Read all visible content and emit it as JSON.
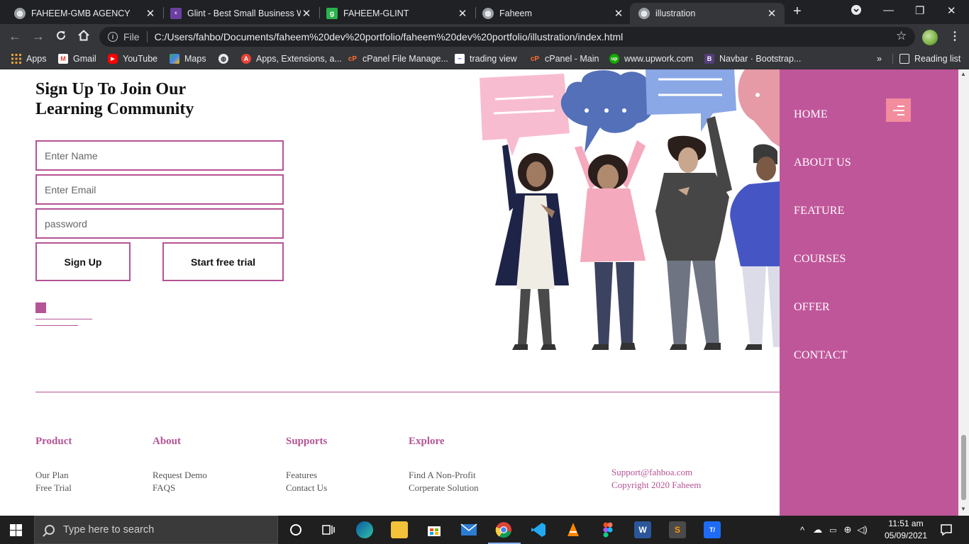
{
  "browser": {
    "tabs": [
      {
        "title": "FAHEEM-GMB AGENCY",
        "icon": "globe-icon",
        "color": "#9aa0a6"
      },
      {
        "title": "Glint - Best Small Business W",
        "icon": "colorlib-icon",
        "color": "#6b3fa0",
        "glyph": "c"
      },
      {
        "title": "FAHEEM-GLINT",
        "icon": "glint-g-icon",
        "color": "#2bb24c",
        "glyph": "g"
      },
      {
        "title": "Faheem",
        "icon": "globe-icon",
        "color": "#9aa0a6"
      },
      {
        "title": "illustration",
        "icon": "globe-icon",
        "color": "#9aa0a6"
      }
    ],
    "new_tab": "+",
    "address": {
      "scheme_label": "File",
      "url": "C:/Users/fahbo/Documents/faheem%20dev%20portfolio/faheem%20dev%20portfolio/illustration/index.html"
    },
    "bookmarks": [
      {
        "label": "Apps",
        "icon": "apps-grid-icon",
        "color": "#e8eaed"
      },
      {
        "label": "Gmail",
        "icon": "gmail-icon",
        "color": "#ea4335",
        "glyph": "M"
      },
      {
        "label": "YouTube",
        "icon": "youtube-icon",
        "color": "#ff0000",
        "glyph": "▶"
      },
      {
        "label": "Maps",
        "icon": "maps-icon",
        "color": "#34a853",
        "glyph": "◆"
      },
      {
        "label": "",
        "icon": "globe-icon",
        "color": "#e8eaed"
      },
      {
        "label": "Apps, Extensions, a...",
        "icon": "extensions-icon",
        "color": "#ea4335",
        "glyph": "A"
      },
      {
        "label": "cPanel File Manage...",
        "icon": "cpanel-icon",
        "color": "#ff6c2c",
        "glyph": "cP"
      },
      {
        "label": "trading view",
        "icon": "tradingview-icon",
        "color": "#2962ff",
        "glyph": "~"
      },
      {
        "label": "cPanel - Main",
        "icon": "cpanel-icon",
        "color": "#ff6c2c",
        "glyph": "cP"
      },
      {
        "label": "www.upwork.com",
        "icon": "upwork-icon",
        "color": "#14a800",
        "glyph": "up"
      },
      {
        "label": "Navbar · Bootstrap...",
        "icon": "bootstrap-icon",
        "color": "#563d7c",
        "glyph": "B"
      }
    ],
    "more": "»",
    "reading_list": "Reading list"
  },
  "signup": {
    "title": "Sign Up To Join Our Learning Community",
    "name_placeholder": "Enter Name",
    "email_placeholder": "Enter Email",
    "password_placeholder": "password",
    "signup_label": "Sign Up",
    "trial_label": "Start free trial"
  },
  "footer": {
    "columns": [
      {
        "heading": "Product",
        "links": [
          "Our Plan",
          "Free Trial"
        ]
      },
      {
        "heading": "About",
        "links": [
          "Request Demo",
          "FAQS"
        ]
      },
      {
        "heading": "Supports",
        "links": [
          "Features",
          "Contact Us"
        ]
      },
      {
        "heading": "Explore",
        "links": [
          "Find A Non-Profit",
          "Corperate Solution"
        ]
      }
    ],
    "email": "Support@fahboa.com",
    "copyright": "Copyright 2020 Faheem"
  },
  "sidenav": {
    "items": [
      "HOME",
      "ABOUT US",
      "FEATURE",
      "COURSES",
      "OFFER",
      "CONTACT"
    ],
    "accent": "#c0569a",
    "toggle_color": "#f38c9d"
  },
  "taskbar": {
    "search_placeholder": "Type here to search",
    "time": "11:51 am",
    "date": "05/09/2021"
  },
  "colors": {
    "brand": "#b55495"
  }
}
